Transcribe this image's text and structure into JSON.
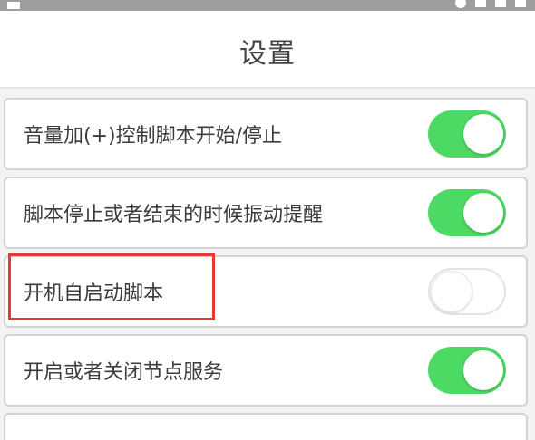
{
  "header": {
    "title": "设置"
  },
  "settings": [
    {
      "label": "音量加(+)控制脚本开始/停止",
      "enabled": true
    },
    {
      "label": "脚本停止或者结束的时候振动提醒",
      "enabled": true
    },
    {
      "label": "开机自启动脚本",
      "enabled": false
    },
    {
      "label": "开启或者关闭节点服务",
      "enabled": true
    }
  ],
  "colors": {
    "toggle_on": "#4cd964",
    "highlight": "#e53935"
  }
}
